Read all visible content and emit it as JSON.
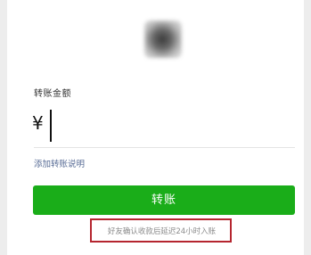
{
  "payee": {
    "avatar_icon": "blurred-avatar"
  },
  "transfer": {
    "amount_label": "转账金额",
    "currency_symbol": "¥",
    "amount_value": "",
    "add_note_link": "添加转账说明",
    "submit_label": "转账",
    "delay_notice": "好友确认收款后延迟24小时入账"
  },
  "colors": {
    "primary_button": "#1aad19",
    "link": "#576b95",
    "highlight_border": "#b5252f",
    "background": "#ededed"
  }
}
